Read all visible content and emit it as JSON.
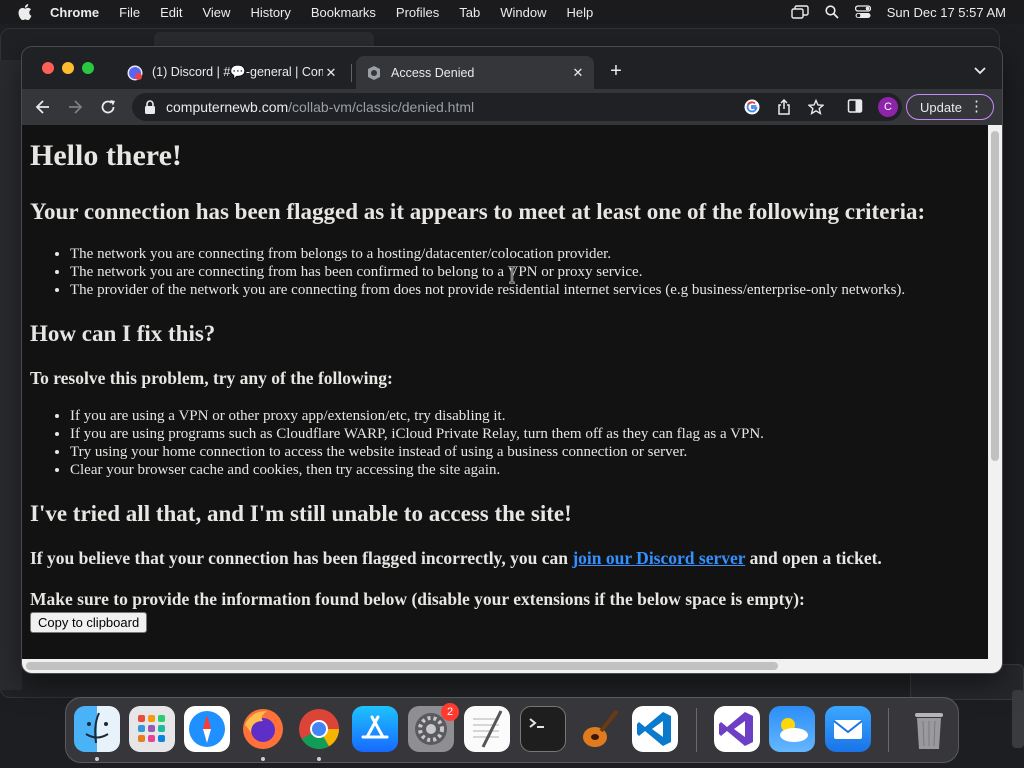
{
  "menubar": {
    "app_name": "Chrome",
    "items": [
      "File",
      "Edit",
      "View",
      "History",
      "Bookmarks",
      "Profiles",
      "Tab",
      "Window",
      "Help"
    ],
    "clock": "Sun Dec 17  5:57 AM"
  },
  "browser": {
    "tabs": [
      {
        "title": "(1) Discord | #💬-general | Com",
        "favicon": "discord-icon",
        "active": false
      },
      {
        "title": "Access Denied",
        "favicon": "collabvm-icon",
        "active": true
      }
    ],
    "url": {
      "domain": "computernewb.com",
      "path": "/collab-vm/classic/denied.html"
    },
    "profile_initial": "C",
    "update_label": "Update"
  },
  "page": {
    "heading": "Hello there!",
    "flag_heading": "Your connection has been flagged as it appears to meet at least one of the following criteria:",
    "criteria": [
      "The network you are connecting from belongs to a hosting/datacenter/colocation provider.",
      "The network you are connecting from has been confirmed to belong to a VPN or proxy service.",
      "The provider of the network you are connecting from does not provide residential internet services (e.g business/enterprise-only networks)."
    ],
    "fix_heading": "How can I fix this?",
    "fix_subheading": "To resolve this problem, try any of the following:",
    "fixes": [
      "If you are using a VPN or other proxy app/extension/etc, try disabling it.",
      "If you are using programs such as Cloudflare WARP, iCloud Private Relay, turn them off as they can flag as a VPN.",
      "Try using your home connection to access the website instead of using a business connection or server.",
      "Clear your browser cache and cookies, then try accessing the site again."
    ],
    "tried_heading": "I've tried all that, and I'm still unable to access the site!",
    "incorrect_prefix": "If you believe that your connection has been flagged incorrectly, you can ",
    "discord_link": "join our Discord server",
    "incorrect_suffix": " and open a ticket.",
    "info_text": "Make sure to provide the information found below (disable your extensions if the below space is empty):",
    "copy_button": "Copy to clipboard"
  },
  "dock": {
    "apps": [
      "finder-icon",
      "launchpad-icon",
      "safari-icon",
      "firefox-icon",
      "chrome-icon",
      "app-store-icon",
      "system-settings-icon",
      "textedit-icon",
      "terminal-icon",
      "garageband-icon",
      "vscode-icon",
      "visual-studio-icon",
      "weather-icon",
      "mail-icon",
      "trash-icon"
    ],
    "settings_badge": "2"
  }
}
